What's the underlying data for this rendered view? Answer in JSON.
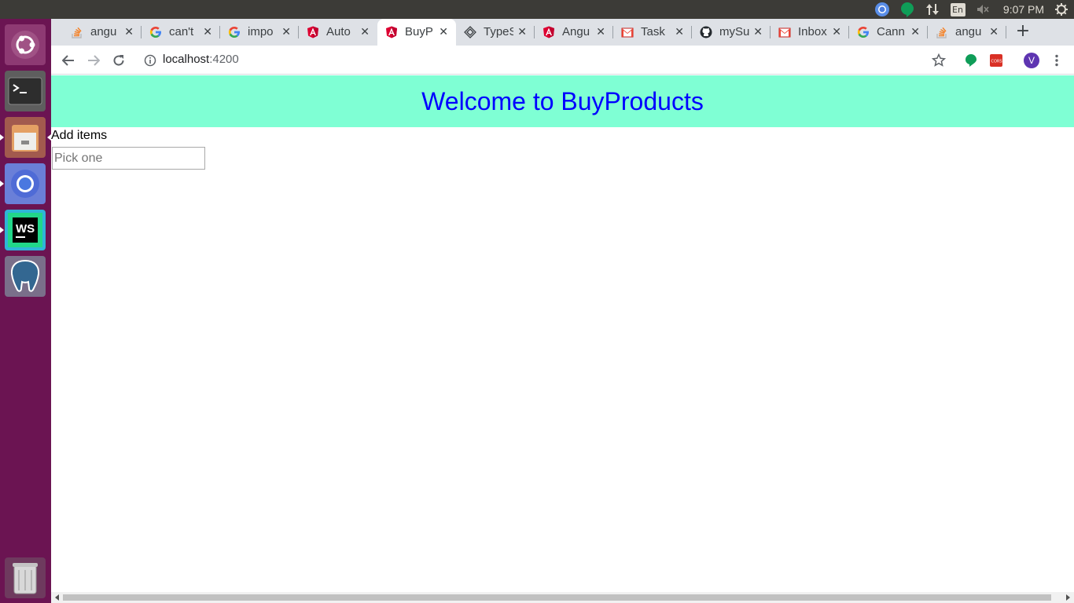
{
  "system": {
    "lang": "En",
    "clock": "9:07 PM"
  },
  "launcher": {
    "items": [
      "ubuntu-dash",
      "terminal",
      "files",
      "chromium",
      "webstorm",
      "pgadmin",
      "trash"
    ]
  },
  "tabs": [
    {
      "title": "angu",
      "icon": "stackoverflow-icon"
    },
    {
      "title": "can't",
      "icon": "google-icon"
    },
    {
      "title": "impo",
      "icon": "google-icon"
    },
    {
      "title": "Auto",
      "icon": "angular-icon"
    },
    {
      "title": "BuyP",
      "icon": "angular-icon",
      "active": true
    },
    {
      "title": "TypeS",
      "icon": "typescript-icon"
    },
    {
      "title": "Angu",
      "icon": "angular-icon"
    },
    {
      "title": "Task",
      "icon": "gmail-icon"
    },
    {
      "title": "mySu",
      "icon": "github-icon"
    },
    {
      "title": "Inbox",
      "icon": "gmail-icon"
    },
    {
      "title": "Cann",
      "icon": "google-icon"
    },
    {
      "title": "angu",
      "icon": "stackoverflow-icon"
    }
  ],
  "toolbar": {
    "url_host": "localhost",
    "url_port": ":4200",
    "profile_initial": "V"
  },
  "page": {
    "banner_title": "Welcome to BuyProducts",
    "add_label": "Add items",
    "input_placeholder": "Pick one",
    "input_value": ""
  },
  "colors": {
    "banner_bg": "#7fffd4",
    "banner_text": "#0000ff",
    "launcher_bg": "#6b1452",
    "panel_bg": "#3c3b37"
  }
}
